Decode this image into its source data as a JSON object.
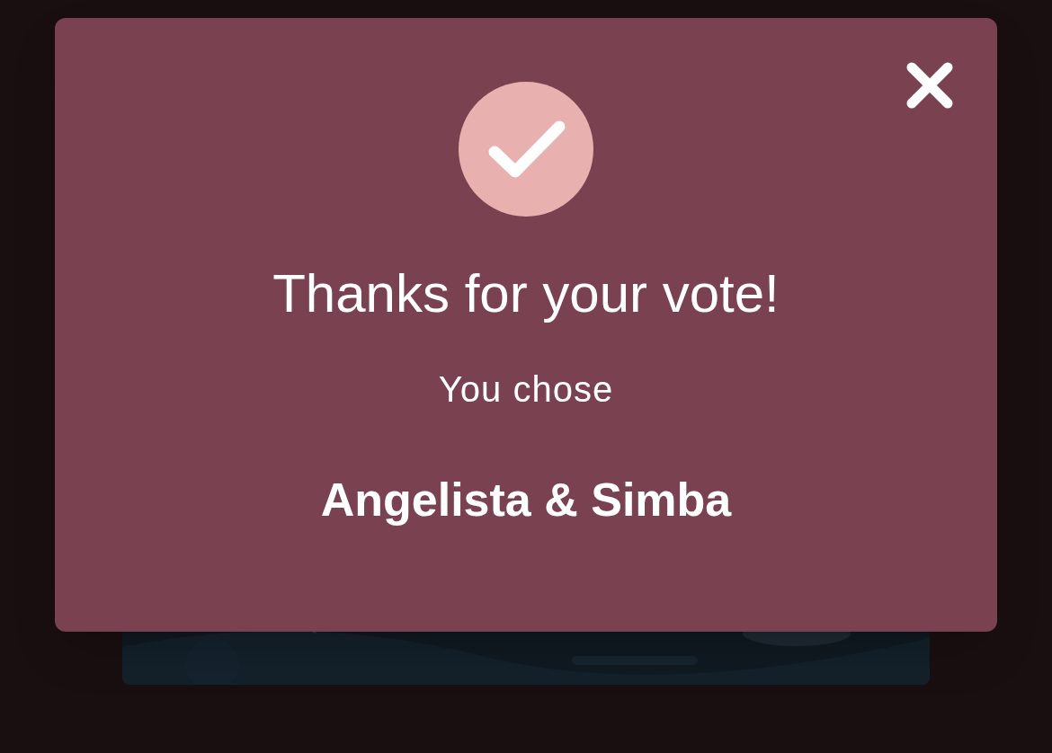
{
  "dialog": {
    "title": "Thanks for your vote!",
    "subtitle": "You chose",
    "choice": "Angelista & Simba"
  }
}
